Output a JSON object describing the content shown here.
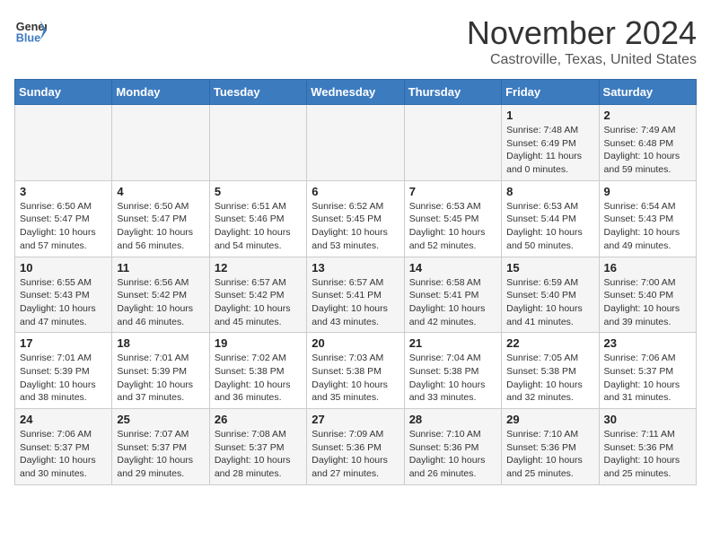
{
  "header": {
    "logo_line1": "General",
    "logo_line2": "Blue",
    "title": "November 2024",
    "subtitle": "Castroville, Texas, United States"
  },
  "calendar": {
    "days_of_week": [
      "Sunday",
      "Monday",
      "Tuesday",
      "Wednesday",
      "Thursday",
      "Friday",
      "Saturday"
    ],
    "weeks": [
      [
        {
          "day": "",
          "info": ""
        },
        {
          "day": "",
          "info": ""
        },
        {
          "day": "",
          "info": ""
        },
        {
          "day": "",
          "info": ""
        },
        {
          "day": "",
          "info": ""
        },
        {
          "day": "1",
          "info": "Sunrise: 7:48 AM\nSunset: 6:49 PM\nDaylight: 11 hours and 0 minutes."
        },
        {
          "day": "2",
          "info": "Sunrise: 7:49 AM\nSunset: 6:48 PM\nDaylight: 10 hours and 59 minutes."
        }
      ],
      [
        {
          "day": "3",
          "info": "Sunrise: 6:50 AM\nSunset: 5:47 PM\nDaylight: 10 hours and 57 minutes."
        },
        {
          "day": "4",
          "info": "Sunrise: 6:50 AM\nSunset: 5:47 PM\nDaylight: 10 hours and 56 minutes."
        },
        {
          "day": "5",
          "info": "Sunrise: 6:51 AM\nSunset: 5:46 PM\nDaylight: 10 hours and 54 minutes."
        },
        {
          "day": "6",
          "info": "Sunrise: 6:52 AM\nSunset: 5:45 PM\nDaylight: 10 hours and 53 minutes."
        },
        {
          "day": "7",
          "info": "Sunrise: 6:53 AM\nSunset: 5:45 PM\nDaylight: 10 hours and 52 minutes."
        },
        {
          "day": "8",
          "info": "Sunrise: 6:53 AM\nSunset: 5:44 PM\nDaylight: 10 hours and 50 minutes."
        },
        {
          "day": "9",
          "info": "Sunrise: 6:54 AM\nSunset: 5:43 PM\nDaylight: 10 hours and 49 minutes."
        }
      ],
      [
        {
          "day": "10",
          "info": "Sunrise: 6:55 AM\nSunset: 5:43 PM\nDaylight: 10 hours and 47 minutes."
        },
        {
          "day": "11",
          "info": "Sunrise: 6:56 AM\nSunset: 5:42 PM\nDaylight: 10 hours and 46 minutes."
        },
        {
          "day": "12",
          "info": "Sunrise: 6:57 AM\nSunset: 5:42 PM\nDaylight: 10 hours and 45 minutes."
        },
        {
          "day": "13",
          "info": "Sunrise: 6:57 AM\nSunset: 5:41 PM\nDaylight: 10 hours and 43 minutes."
        },
        {
          "day": "14",
          "info": "Sunrise: 6:58 AM\nSunset: 5:41 PM\nDaylight: 10 hours and 42 minutes."
        },
        {
          "day": "15",
          "info": "Sunrise: 6:59 AM\nSunset: 5:40 PM\nDaylight: 10 hours and 41 minutes."
        },
        {
          "day": "16",
          "info": "Sunrise: 7:00 AM\nSunset: 5:40 PM\nDaylight: 10 hours and 39 minutes."
        }
      ],
      [
        {
          "day": "17",
          "info": "Sunrise: 7:01 AM\nSunset: 5:39 PM\nDaylight: 10 hours and 38 minutes."
        },
        {
          "day": "18",
          "info": "Sunrise: 7:01 AM\nSunset: 5:39 PM\nDaylight: 10 hours and 37 minutes."
        },
        {
          "day": "19",
          "info": "Sunrise: 7:02 AM\nSunset: 5:38 PM\nDaylight: 10 hours and 36 minutes."
        },
        {
          "day": "20",
          "info": "Sunrise: 7:03 AM\nSunset: 5:38 PM\nDaylight: 10 hours and 35 minutes."
        },
        {
          "day": "21",
          "info": "Sunrise: 7:04 AM\nSunset: 5:38 PM\nDaylight: 10 hours and 33 minutes."
        },
        {
          "day": "22",
          "info": "Sunrise: 7:05 AM\nSunset: 5:38 PM\nDaylight: 10 hours and 32 minutes."
        },
        {
          "day": "23",
          "info": "Sunrise: 7:06 AM\nSunset: 5:37 PM\nDaylight: 10 hours and 31 minutes."
        }
      ],
      [
        {
          "day": "24",
          "info": "Sunrise: 7:06 AM\nSunset: 5:37 PM\nDaylight: 10 hours and 30 minutes."
        },
        {
          "day": "25",
          "info": "Sunrise: 7:07 AM\nSunset: 5:37 PM\nDaylight: 10 hours and 29 minutes."
        },
        {
          "day": "26",
          "info": "Sunrise: 7:08 AM\nSunset: 5:37 PM\nDaylight: 10 hours and 28 minutes."
        },
        {
          "day": "27",
          "info": "Sunrise: 7:09 AM\nSunset: 5:36 PM\nDaylight: 10 hours and 27 minutes."
        },
        {
          "day": "28",
          "info": "Sunrise: 7:10 AM\nSunset: 5:36 PM\nDaylight: 10 hours and 26 minutes."
        },
        {
          "day": "29",
          "info": "Sunrise: 7:10 AM\nSunset: 5:36 PM\nDaylight: 10 hours and 25 minutes."
        },
        {
          "day": "30",
          "info": "Sunrise: 7:11 AM\nSunset: 5:36 PM\nDaylight: 10 hours and 25 minutes."
        }
      ]
    ]
  }
}
